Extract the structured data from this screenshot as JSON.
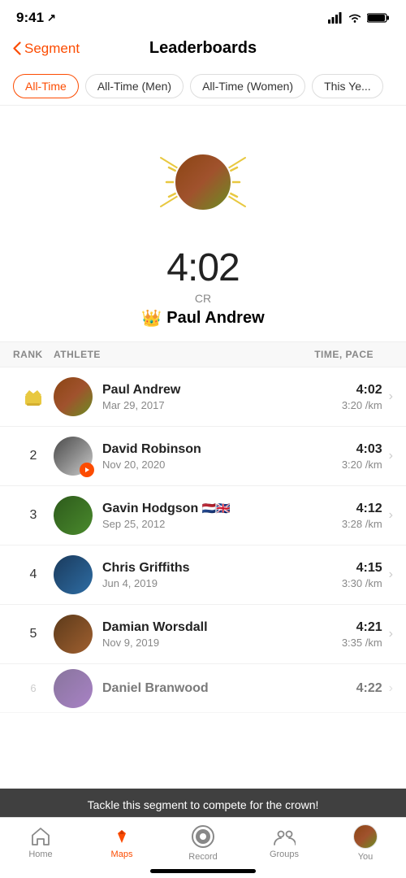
{
  "statusBar": {
    "time": "9:41",
    "locationIcon": "↗"
  },
  "header": {
    "backLabel": "Segment",
    "title": "Leaderboards"
  },
  "filterTabs": [
    {
      "id": "all-time",
      "label": "All-Time",
      "active": true
    },
    {
      "id": "all-time-men",
      "label": "All-Time (Men)",
      "active": false
    },
    {
      "id": "all-time-women",
      "label": "All-Time (Women)",
      "active": false
    },
    {
      "id": "this-year",
      "label": "This Ye...",
      "active": false
    }
  ],
  "champion": {
    "time": "4:02",
    "cr": "CR",
    "name": "Paul Andrew",
    "crownEmoji": "👑"
  },
  "tableHeader": {
    "rank": "RANK",
    "athlete": "ATHLETE",
    "timePace": "TIME, PACE"
  },
  "rows": [
    {
      "rank": "crown",
      "rankDisplay": "🏆",
      "name": "Paul Andrew",
      "date": "Mar 29, 2017",
      "flags": "",
      "time": "4:02",
      "pace": "3:20 /km",
      "avatarClass": "avatar-1"
    },
    {
      "rank": "2",
      "rankDisplay": "2",
      "name": "David Robinson",
      "date": "Nov 20, 2020",
      "flags": "",
      "time": "4:03",
      "pace": "3:20 /km",
      "avatarClass": "avatar-2",
      "hasBadge": true
    },
    {
      "rank": "3",
      "rankDisplay": "3",
      "name": "Gavin Hodgson",
      "date": "Sep 25, 2012",
      "flags": "🇳🇱🇬🇧",
      "time": "4:12",
      "pace": "3:28 /km",
      "avatarClass": "avatar-3"
    },
    {
      "rank": "4",
      "rankDisplay": "4",
      "name": "Chris Griffiths",
      "date": "Jun 4, 2019",
      "flags": "",
      "time": "4:15",
      "pace": "3:30 /km",
      "avatarClass": "avatar-4"
    },
    {
      "rank": "5",
      "rankDisplay": "5",
      "name": "Damian Worsdall",
      "date": "Nov 9, 2019",
      "flags": "",
      "time": "4:21",
      "pace": "3:35 /km",
      "avatarClass": "avatar-5"
    },
    {
      "rank": "6",
      "rankDisplay": "6",
      "name": "Daniel Branwood",
      "date": "",
      "flags": "",
      "time": "4:22",
      "pace": "",
      "avatarClass": "avatar-6",
      "partial": true
    }
  ],
  "banner": {
    "text": "Tackle this segment to compete for the crown!"
  },
  "bottomNav": [
    {
      "id": "home",
      "label": "Home",
      "icon": "home",
      "active": false
    },
    {
      "id": "maps",
      "label": "Maps",
      "icon": "maps",
      "active": true
    },
    {
      "id": "record",
      "label": "Record",
      "icon": "record",
      "active": false
    },
    {
      "id": "groups",
      "label": "Groups",
      "icon": "groups",
      "active": false
    },
    {
      "id": "you",
      "label": "You",
      "icon": "you",
      "active": false
    }
  ]
}
